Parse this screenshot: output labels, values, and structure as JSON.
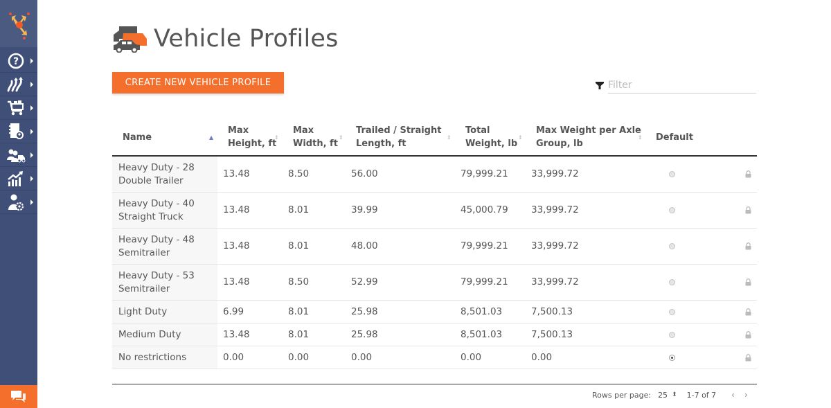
{
  "sidebar": {
    "logo": "route-planner-logo",
    "items": [
      {
        "icon": "help-icon"
      },
      {
        "icon": "routes-icon"
      },
      {
        "icon": "cart-icon"
      },
      {
        "icon": "address-book-icon"
      },
      {
        "icon": "team-vehicle-icon"
      },
      {
        "icon": "analytics-icon"
      },
      {
        "icon": "user-settings-icon"
      }
    ],
    "chat_icon": "chat-icon"
  },
  "header": {
    "title": "Vehicle Profiles",
    "icon": "vehicles-icon"
  },
  "toolbar": {
    "create_label": "CREATE NEW VEHICLE PROFILE",
    "filter_placeholder": "Filter",
    "filter_value": ""
  },
  "table": {
    "columns": [
      {
        "label": "Name",
        "sort": "asc"
      },
      {
        "label": "Max Height, ft",
        "line1": "Max",
        "line2": "Height, ft",
        "sort": "none"
      },
      {
        "label": "Max Width, ft",
        "line1": "Max",
        "line2": "Width, ft",
        "sort": "none"
      },
      {
        "label": "Trailed / Straight Length, ft",
        "line1": "Trailed / Straight",
        "line2": "Length, ft",
        "sort": "none"
      },
      {
        "label": "Total Weight, lb",
        "line1": "Total",
        "line2": "Weight, lb",
        "sort": "none"
      },
      {
        "label": "Max Weight per Axle Group, lb",
        "line1": "Max Weight per Axle",
        "line2": "Group, lb",
        "sort": "none"
      },
      {
        "label": "Default"
      }
    ],
    "rows": [
      {
        "name_line1": "Heavy Duty - 28",
        "name_line2": "Double Trailer",
        "height": "13.48",
        "width": "8.50",
        "length": "56.00",
        "total_weight": "79,999.21",
        "axle_weight": "33,999.72",
        "default": false,
        "locked": true
      },
      {
        "name_line1": "Heavy Duty - 40",
        "name_line2": "Straight Truck",
        "height": "13.48",
        "width": "8.01",
        "length": "39.99",
        "total_weight": "45,000.79",
        "axle_weight": "33,999.72",
        "default": false,
        "locked": true
      },
      {
        "name_line1": "Heavy Duty - 48",
        "name_line2": "Semitrailer",
        "height": "13.48",
        "width": "8.01",
        "length": "48.00",
        "total_weight": "79,999.21",
        "axle_weight": "33,999.72",
        "default": false,
        "locked": true
      },
      {
        "name_line1": "Heavy Duty - 53",
        "name_line2": "Semitrailer",
        "height": "13.48",
        "width": "8.50",
        "length": "52.99",
        "total_weight": "79,999.21",
        "axle_weight": "33,999.72",
        "default": false,
        "locked": true
      },
      {
        "name_line1": "Light Duty",
        "name_line2": "",
        "height": "6.99",
        "width": "8.01",
        "length": "25.98",
        "total_weight": "8,501.03",
        "axle_weight": "7,500.13",
        "default": false,
        "locked": true
      },
      {
        "name_line1": "Medium Duty",
        "name_line2": "",
        "height": "13.48",
        "width": "8.01",
        "length": "25.98",
        "total_weight": "8,501.03",
        "axle_weight": "7,500.13",
        "default": false,
        "locked": true
      },
      {
        "name_line1": "No restrictions",
        "name_line2": "",
        "height": "0.00",
        "width": "0.00",
        "length": "0.00",
        "total_weight": "0.00",
        "axle_weight": "0.00",
        "default": true,
        "locked": true
      }
    ]
  },
  "pagination": {
    "rows_per_page_label": "Rows per page:",
    "rows_per_page": "25",
    "range": "1-7 of 7",
    "prev": "‹",
    "next": "›"
  },
  "colors": {
    "sidebar": "#3f4f77",
    "accent": "#f36f2b",
    "sort_active": "#6a7fc0"
  }
}
